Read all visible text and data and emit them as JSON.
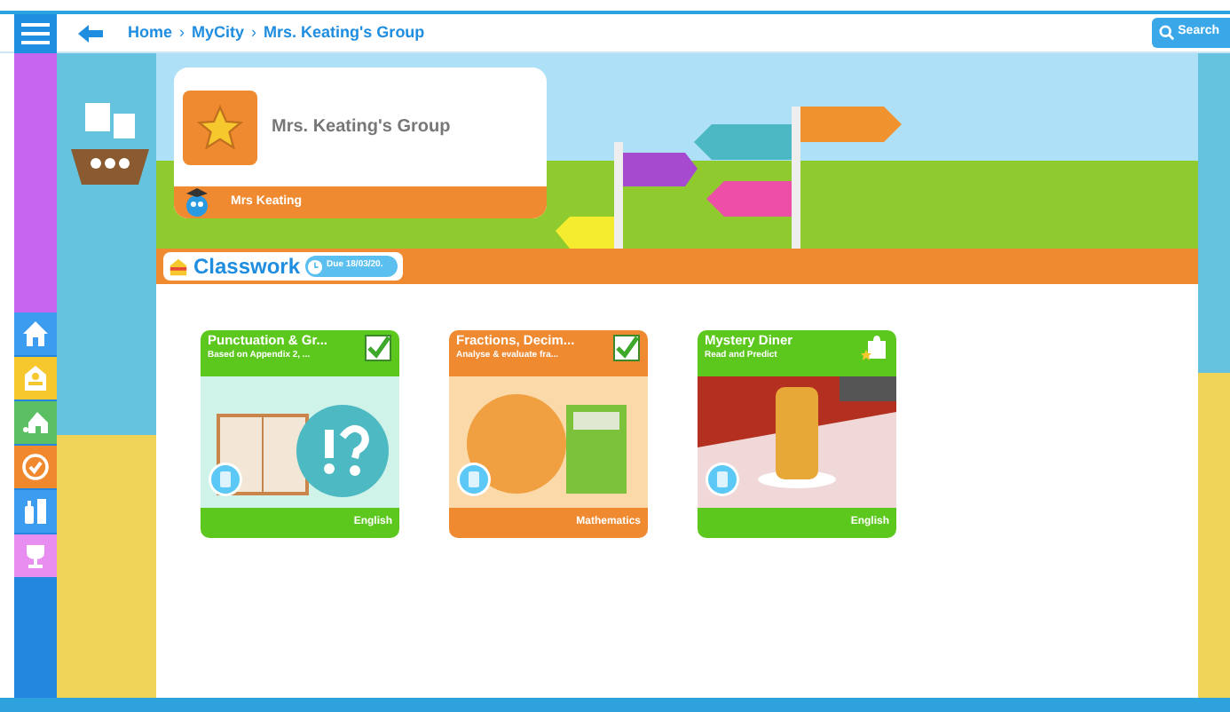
{
  "breadcrumb": [
    {
      "label": "Home"
    },
    {
      "label": "MyCity"
    },
    {
      "label": "Mrs. Keating's Group"
    }
  ],
  "breadcrumb_separator": "›",
  "search": {
    "label": "Search"
  },
  "side_nav": [
    {
      "kind": "home",
      "color": "#3b9cf0"
    },
    {
      "kind": "school",
      "color": "#f7c82e"
    },
    {
      "kind": "house",
      "color": "#5bbf63"
    },
    {
      "kind": "check",
      "color": "#f0882e"
    },
    {
      "kind": "supplies",
      "color": "#3b9cf0"
    },
    {
      "kind": "trophy",
      "color": "#e88ef0"
    }
  ],
  "group": {
    "name": "Mrs. Keating's Group",
    "teacher": "Mrs Keating"
  },
  "section": {
    "title": "Classwork",
    "due": "Due 18/03/20."
  },
  "cards": [
    {
      "title": "Punctuation & Gr...",
      "subtitle": "Based on Appendix 2, ...",
      "subject": "English",
      "color": "#5cc81e",
      "assessed": true,
      "kind": "punctuation"
    },
    {
      "title": "Fractions, Decim...",
      "subtitle": "Analyse & evaluate fra...",
      "subject": "Mathematics",
      "color": "#f08a30",
      "assessed": true,
      "kind": "fractions"
    },
    {
      "title": "Mystery Diner",
      "subtitle": "Read and Predict",
      "subject": "English",
      "color": "#5cc81e",
      "assessed": false,
      "kind": "diner"
    }
  ]
}
